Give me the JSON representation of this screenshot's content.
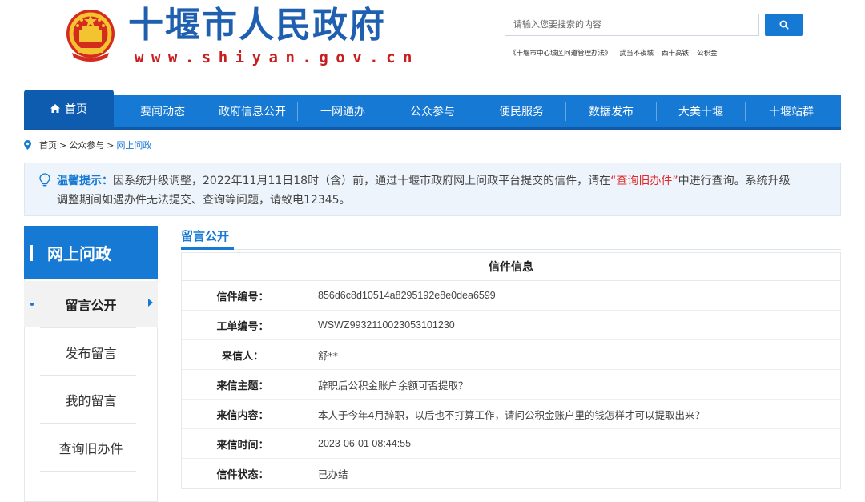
{
  "header": {
    "site_title": "十堰市人民政府",
    "site_domain": "www.shiyan.gov.cn",
    "search_placeholder": "请输入您要搜索的内容",
    "hot_links": [
      "《十堰市中心城区问道管理办法》",
      "武当不夜城",
      "西十高铁",
      "公积金"
    ]
  },
  "nav": {
    "home": "首页",
    "items": [
      "要闻动态",
      "政府信息公开",
      "一网通办",
      "公众参与",
      "便民服务",
      "数据发布",
      "大美十堰",
      "十堰站群"
    ]
  },
  "breadcrumb": [
    "首页",
    "公众参与",
    "网上问政"
  ],
  "notice": {
    "label": "温馨提示：",
    "text_before_link": "因系统升级调整，2022年11月11日18时（含）前，通过十堰市政府网上问政平台提交的信件，请在",
    "link": "“查询旧办件”",
    "text_after_link": "中进行查询。系统升级",
    "line2": "调整期间如遇办件无法提交、查询等问题，请致电12345。"
  },
  "sidebar": {
    "title": "网上问政",
    "items": [
      "留言公开",
      "发布留言",
      "我的留言",
      "查询旧办件"
    ]
  },
  "content": {
    "section_title": "留言公开",
    "table_caption": "信件信息",
    "rows": [
      {
        "key": "信件编号：",
        "value": "856d6c8d10514a8295192e8e0dea6599"
      },
      {
        "key": "工单编号：",
        "value": "WSWZ9932110023053101230"
      },
      {
        "key": "来信人：",
        "value": "舒**"
      },
      {
        "key": "来信主题：",
        "value": "辞职后公积金账户余额可否提取？"
      },
      {
        "key": "来信内容：",
        "value": "本人于今年4月辞职，以后也不打算工作，请问公积金账户里的钱怎样才可以提取出来？"
      },
      {
        "key": "来信时间：",
        "value": "2023-06-01 08:44:55"
      },
      {
        "key": "信件状态：",
        "value": "已办结"
      }
    ]
  },
  "colors": {
    "primary": "#1679d3",
    "title_blue": "#1f5fb0",
    "domain_red": "#c81e1e",
    "link_red": "#e02a2a"
  },
  "icons": {
    "emblem": "national-emblem-icon",
    "search": "search-icon",
    "home": "home-icon",
    "location": "location-pin-icon",
    "notice": "lightbulb-icon",
    "caret": "caret-right-icon"
  }
}
